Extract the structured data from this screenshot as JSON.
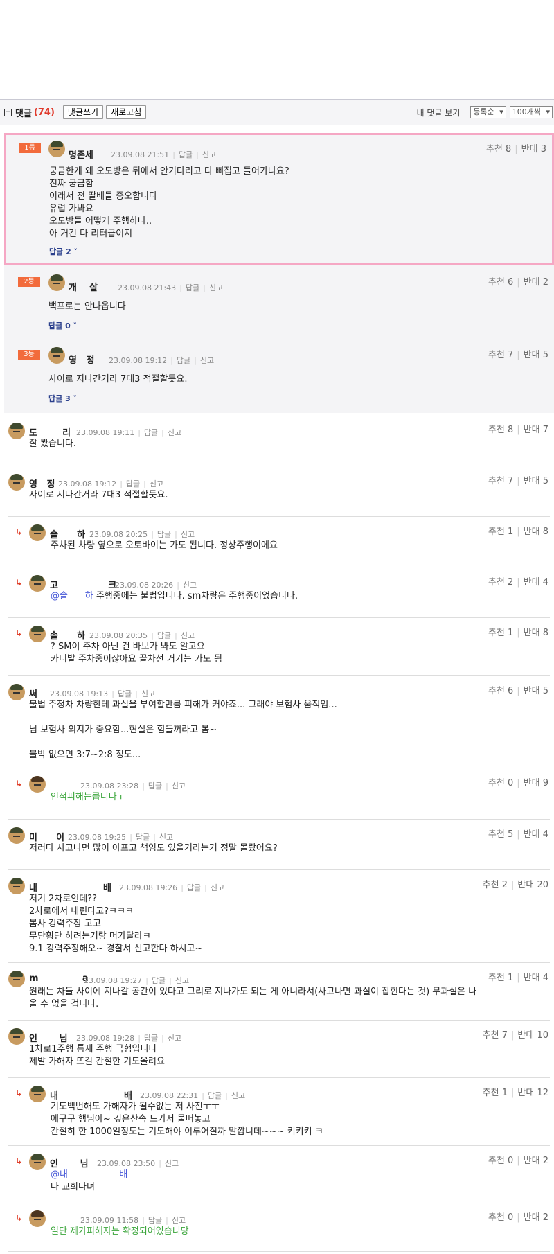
{
  "toolbar": {
    "toggle_icon": "minus-box-icon",
    "title": "댓글",
    "count": "(74)",
    "write_label": "댓글쓰기",
    "refresh_label": "새로고침",
    "my_comments_label": "내 댓글 보기",
    "sort_value": "등록순",
    "page_size_value": "100개씩"
  },
  "labels": {
    "reply": "답글",
    "report": "신고",
    "up": "추천",
    "down": "반대"
  },
  "best": [
    {
      "rank": "1등",
      "nick": "명존세",
      "time": "23.09.08 21:51",
      "up": "8",
      "down": "3",
      "body": "궁금한게 왜 오도방은 뒤에서 안기다리고 다 삐집고 들어가나요?\n진짜 궁금함\n이래서 전 딸배들 증오합니다\n유럽 가봐요\n오도방들 어떻게 주행하나..\n아 거긴 다 리터급이지",
      "replies": "답글 2 ˅"
    },
    {
      "rank": "2등",
      "nick": "개    살",
      "time": "23.09.08 21:43",
      "up": "6",
      "down": "2",
      "body": "백프로는 안나옵니다",
      "replies": "답글 0 ˅"
    },
    {
      "rank": "3등",
      "nick": "영   정",
      "time": "23.09.08 19:12",
      "up": "7",
      "down": "5",
      "body": "사이로 지나간거라 7대3 적절할듯요.",
      "replies": "답글 3 ˅"
    }
  ],
  "comments": [
    {
      "nick": "도        리",
      "time": "23.09.08 19:11",
      "up": "8",
      "down": "7",
      "body": "잘 봤습니다."
    },
    {
      "nick": "영   정",
      "time": "23.09.08 19:12",
      "up": "7",
      "down": "5",
      "body": "사이로 지나간거라 7대3 적절할듯요."
    },
    {
      "nick": "솔      하",
      "time": "23.09.08 20:25",
      "up": "1",
      "down": "8",
      "body": "주차된 차량 옆으로 오토바이는 가도 됩니다. 정상주행이에요"
    },
    {
      "nick": "고                크",
      "time": "23.09.08 20:26",
      "up": "2",
      "down": "4",
      "mention": "@솔      하",
      "body": " 주행중에는 불법입니다. sm차량은 주행중이었습니다."
    },
    {
      "nick": "솔      하",
      "time": "23.09.08 20:35",
      "up": "1",
      "down": "8",
      "body": "? SM이 주차 아닌 건 바보가 봐도 알고요\n카니발 주차중이잖아요 끝차선 거기는 가도 됨"
    },
    {
      "nick": "써",
      "time": "23.09.08 19:13",
      "up": "6",
      "down": "5",
      "body": "불법 주정차 차량한테 과실을 부여할만큼 피해가 커야죠... 그래야 보험사 움직임...\n\n님 보험사 의지가 중요함...현실은 힘들꺼라고 봄~\n\n블박 없으면 3:7~2:8 정도..."
    },
    {
      "nick": "",
      "time": "23.09.08 23:28",
      "up": "0",
      "down": "9",
      "body": "인적피해는큽니다ㅜ"
    },
    {
      "nick": "미      이",
      "time": "23.09.08 19:25",
      "up": "5",
      "down": "4",
      "body": "저러다 사고나면 많이 아프고 책임도 있을거라는거 정말 몰랐어요?"
    },
    {
      "nick": "내                     배",
      "time": "23.09.08 19:26",
      "up": "2",
      "down": "20",
      "body": "저기 2차로인데??\n2차로에서 내린다고?ㅋㅋㅋ\n봄사 강력주장 고고\n무단횡단 하려는거랑 머가달라ㅋ\n9.1 강력주장해오~ 경찰서 신고한다 하시고~"
    },
    {
      "nick": "m              a",
      "time": "23.09.08 19:27",
      "up": "1",
      "down": "4",
      "body": "원래는 차들 사이에 지나갈 공간이 있다고 그리로 지나가도 되는 게 아니라서(사고나면 과실이 잡힌다는 것) 무과실은 나\n올 수 없을 겁니다."
    },
    {
      "nick": "인       님",
      "time": "23.09.08 19:28",
      "up": "7",
      "down": "10",
      "body": "1차로1주행 틈새 주행 극혐입니다\n제발 가해자 뜨길 간절한 기도올려요"
    },
    {
      "nick": "내                     배",
      "time": "23.09.08 22:31",
      "up": "1",
      "down": "12",
      "body": "기도백번해도 가해자가 될수없는 저 사진ㅜㅜ\n에구구 행님아~ 깊은산속 드가서 물떠놓고\n간절히 한 1000일정도는 기도해야 이루어질까 말깝니데~~~ 키키키 ㅋ"
    },
    {
      "nick": "인       님",
      "time": "23.09.08 23:50",
      "up": "0",
      "down": "2",
      "mention": "@내                  배",
      "body": "나 교회다녀"
    },
    {
      "nick": "",
      "time": "23.09.09 11:58",
      "up": "0",
      "down": "2",
      "body": "일단 제가피해자는 확정되어있습니당"
    }
  ]
}
